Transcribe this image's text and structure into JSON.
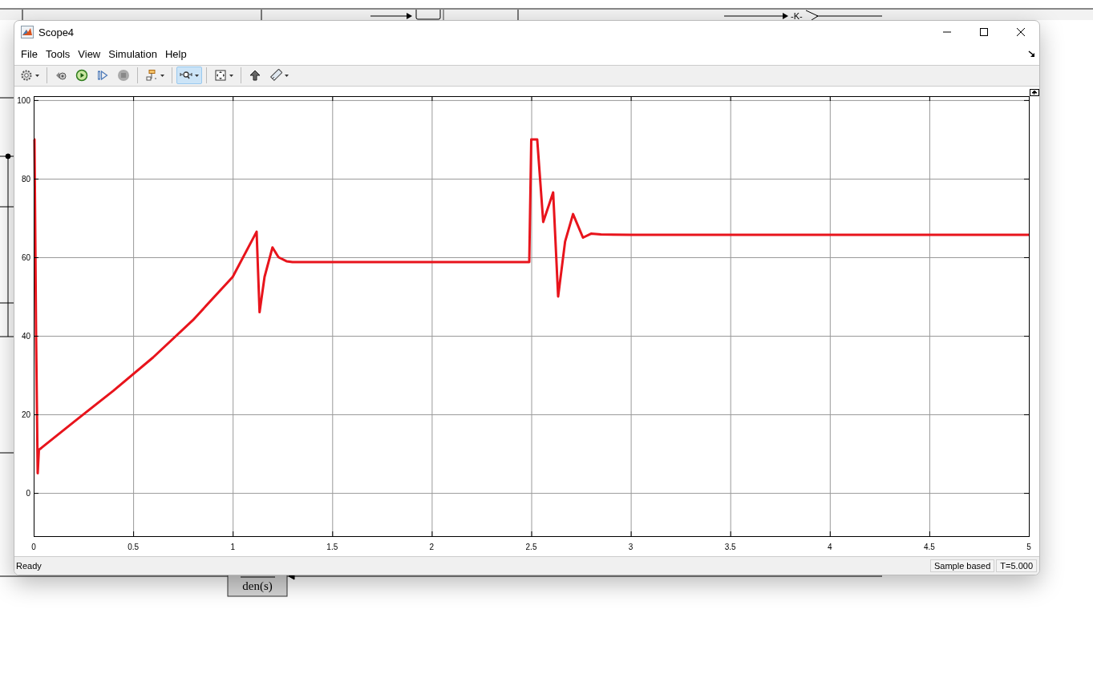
{
  "background": {
    "gain_label": "-K-",
    "block_label": "den(s)"
  },
  "window": {
    "title": "Scope4"
  },
  "menu": [
    "File",
    "Tools",
    "View",
    "Simulation",
    "Help"
  ],
  "toolbar": [
    {
      "kind": "settings",
      "dropdown": true,
      "selected": false
    },
    {
      "kind": "separator"
    },
    {
      "kind": "snapshot",
      "dropdown": false,
      "selected": false
    },
    {
      "kind": "run",
      "dropdown": false,
      "selected": false
    },
    {
      "kind": "step",
      "dropdown": false,
      "selected": false
    },
    {
      "kind": "stop",
      "dropdown": false,
      "selected": false
    },
    {
      "kind": "separator"
    },
    {
      "kind": "blocks",
      "dropdown": true,
      "selected": false
    },
    {
      "kind": "separator"
    },
    {
      "kind": "zoom",
      "dropdown": true,
      "selected": true
    },
    {
      "kind": "separator"
    },
    {
      "kind": "fit",
      "dropdown": true,
      "selected": false
    },
    {
      "kind": "separator"
    },
    {
      "kind": "highlight",
      "dropdown": false,
      "selected": false
    },
    {
      "kind": "measure",
      "dropdown": true,
      "selected": false
    }
  ],
  "plot": {
    "chart_data": {
      "type": "line",
      "xlim": [
        0,
        5
      ],
      "ylim": [
        -11,
        101
      ],
      "xticks": [
        0,
        0.5,
        1,
        1.5,
        2,
        2.5,
        3,
        3.5,
        4,
        4.5,
        5
      ],
      "yticks": [
        0,
        20,
        40,
        60,
        80,
        100
      ],
      "grid": true,
      "x": [
        0,
        0.004,
        0.012,
        0.02,
        0.026,
        0.04,
        0.2,
        0.4,
        0.6,
        0.8,
        1.0,
        1.12,
        1.135,
        1.16,
        1.2,
        1.23,
        1.27,
        1.3,
        1.5,
        2.0,
        2.49,
        2.5,
        2.53,
        2.56,
        2.61,
        2.635,
        2.67,
        2.71,
        2.76,
        2.8,
        2.85,
        3,
        4,
        5
      ],
      "series": [
        {
          "color": "#e8141c",
          "values": [
            90,
            90,
            40,
            5,
            11,
            11.5,
            18,
            26,
            34.5,
            44,
            55,
            66.5,
            46,
            55,
            62.5,
            60,
            59,
            58.8,
            58.8,
            58.8,
            58.8,
            90,
            90,
            69,
            76.5,
            50,
            64,
            71,
            65,
            66,
            65.8,
            65.7,
            65.7,
            65.7
          ]
        }
      ]
    }
  },
  "status_bar": {
    "status": "Ready",
    "mode": "Sample based",
    "time": "T=5.000"
  }
}
